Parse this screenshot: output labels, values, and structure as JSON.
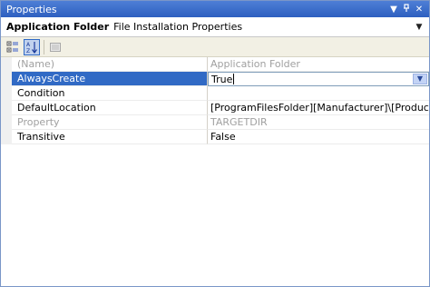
{
  "window": {
    "title": "Properties"
  },
  "object_selector": {
    "name": "Application Folder",
    "type": "File Installation Properties"
  },
  "toolbar": {
    "categorized": "categorized-icon",
    "alphabetical": "alphabetical-icon",
    "property_pages": "property-pages-icon"
  },
  "properties": [
    {
      "name": "(Name)",
      "value": "Application Folder"
    },
    {
      "name": "AlwaysCreate",
      "value": "True"
    },
    {
      "name": "Condition",
      "value": ""
    },
    {
      "name": "DefaultLocation",
      "value": "[ProgramFilesFolder][Manufacturer]\\[ProductName]"
    },
    {
      "name": "Property",
      "value": "TARGETDIR"
    },
    {
      "name": "Transitive",
      "value": "False"
    }
  ],
  "colors": {
    "titlebar": "#2d5fc0",
    "selection": "#316ac5",
    "disabled_text": "#a0a0a0"
  }
}
